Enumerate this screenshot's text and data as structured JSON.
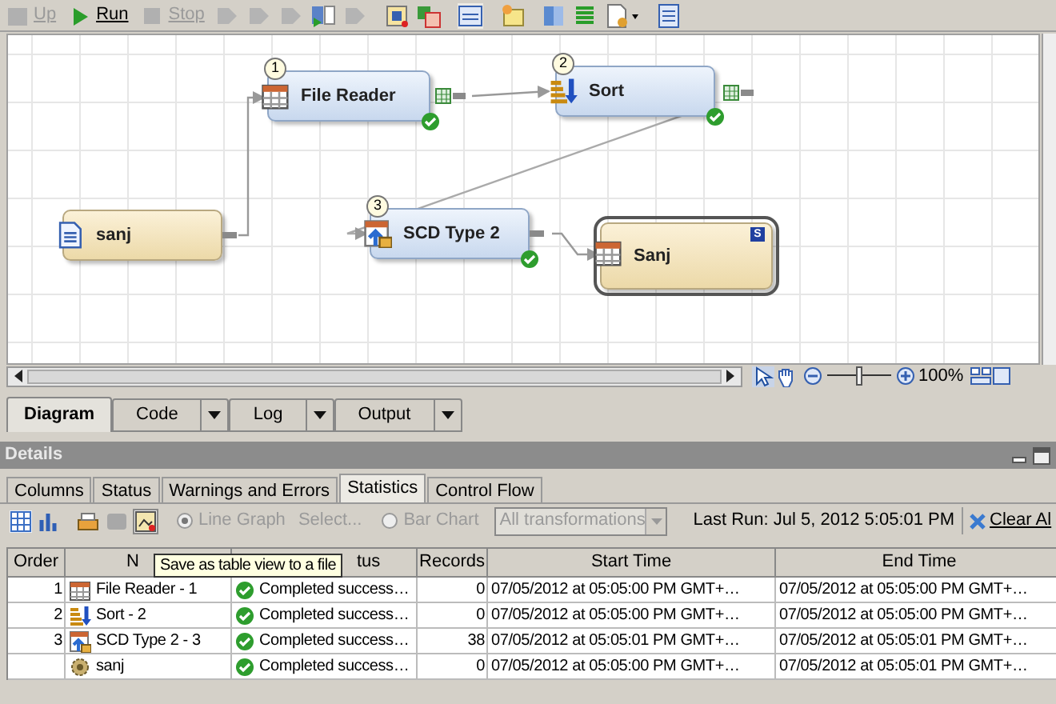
{
  "toolbar": {
    "items": [
      {
        "label": "Up",
        "disabled": true
      },
      {
        "label": "Run",
        "disabled": false
      },
      {
        "label": "Stop",
        "disabled": true
      }
    ]
  },
  "diagram": {
    "nodes": [
      {
        "kind": "transform",
        "label": "File Reader",
        "badge": "1",
        "completed": true,
        "selected": false
      },
      {
        "kind": "sort",
        "label": "Sort",
        "badge": "2",
        "completed": true,
        "selected": false
      },
      {
        "kind": "source",
        "label": "sanj",
        "selected": false
      },
      {
        "kind": "scd",
        "label": "SCD Type 2",
        "badge": "3",
        "completed": true,
        "selected": false
      },
      {
        "kind": "target",
        "label": "Sanj",
        "badge": "S",
        "selected": true
      }
    ],
    "zoom_slider": {
      "level": 0.5
    },
    "zoom": "100%"
  },
  "view_tabs": [
    {
      "label": "Diagram",
      "selected": true,
      "dropdown": false
    },
    {
      "label": "Code",
      "selected": false,
      "dropdown": true
    },
    {
      "label": "Log",
      "selected": false,
      "dropdown": true
    },
    {
      "label": "Output",
      "selected": false,
      "dropdown": true
    }
  ],
  "details": {
    "title": "Details",
    "tabs": [
      {
        "label": "Columns",
        "selected": false
      },
      {
        "label": "Status",
        "selected": false
      },
      {
        "label": "Warnings and Errors",
        "selected": false
      },
      {
        "label": "Statistics",
        "selected": true
      },
      {
        "label": "Control Flow",
        "selected": false
      }
    ],
    "toolbar": {
      "line_graph": {
        "label": "Line Graph",
        "checked": true,
        "disabled": true
      },
      "select": "Select...",
      "bar_chart": {
        "label": "Bar Chart",
        "checked": false,
        "disabled": true
      },
      "filter": "All transformations",
      "last_run": "Last Run: Jul 5, 2012 5:05:01 PM",
      "clear": "Clear Al"
    },
    "table": {
      "columns": [
        "Order",
        "N",
        "tus",
        "Records",
        "Start Time",
        "End Time"
      ],
      "rows": [
        {
          "kind": "reader",
          "order": "1",
          "name": "File Reader - 1",
          "status": "Completed success…",
          "records": "0",
          "start": "07/05/2012 at 05:05:00 PM GMT+…",
          "end": "07/05/2012 at 05:05:00 PM GMT+…"
        },
        {
          "kind": "sort",
          "order": "2",
          "name": "Sort - 2",
          "status": "Completed success…",
          "records": "0",
          "start": "07/05/2012 at 05:05:00 PM GMT+…",
          "end": "07/05/2012 at 05:05:00 PM GMT+…"
        },
        {
          "kind": "scd",
          "order": "3",
          "name": "SCD Type 2 - 3",
          "status": "Completed success…",
          "records": "38",
          "start": "07/05/2012 at 05:05:01 PM GMT+…",
          "end": "07/05/2012 at 05:05:01 PM GMT+…"
        },
        {
          "kind": "job",
          "name": "sanj",
          "status": "Completed success…",
          "records": "0",
          "start": "07/05/2012 at 05:05:00 PM GMT+…",
          "end": "07/05/2012 at 05:05:01 PM GMT+…"
        }
      ]
    },
    "tooltip": "Save as table view to a file"
  }
}
